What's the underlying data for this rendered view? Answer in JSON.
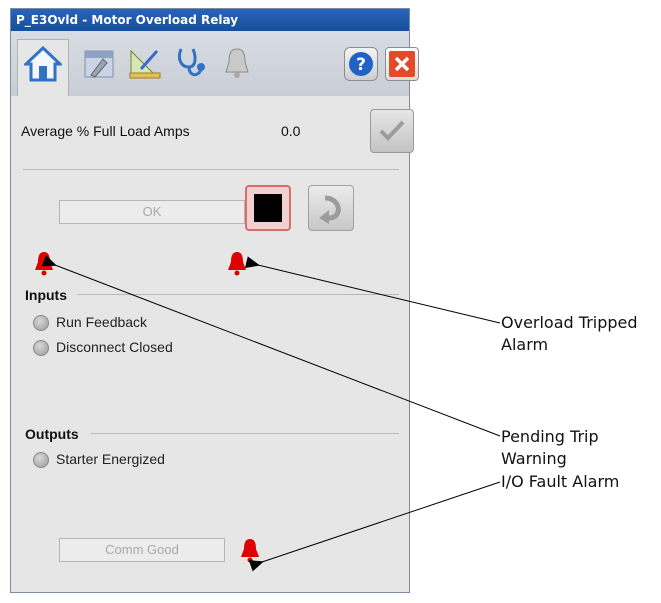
{
  "window": {
    "title": "P_E3Ovld - Motor Overload Relay"
  },
  "tabs": [
    {
      "icon": "home-icon"
    },
    {
      "icon": "maintenance-icon"
    },
    {
      "icon": "engineering-icon"
    },
    {
      "icon": "diagnostics-icon"
    },
    {
      "icon": "alarms-bell-icon"
    }
  ],
  "header_buttons": {
    "help": "?",
    "close": "✕"
  },
  "summary": {
    "label": "Average % Full Load Amps",
    "value": "0.0"
  },
  "status": {
    "state_text": "OK"
  },
  "inputs": {
    "title": "Inputs",
    "items": [
      "Run Feedback",
      "Disconnect Closed"
    ]
  },
  "outputs": {
    "title": "Outputs",
    "items": [
      "Starter Energized"
    ]
  },
  "comm": {
    "status_text": "Comm Good"
  },
  "callouts": {
    "overload": {
      "line1": "Overload Tripped",
      "line2": "Alarm"
    },
    "pending": "Pending Trip Warning",
    "io_fault": "I/O Fault Alarm"
  },
  "colors": {
    "alarm_red": "#e00000",
    "title_blue": "#1f5aae"
  }
}
